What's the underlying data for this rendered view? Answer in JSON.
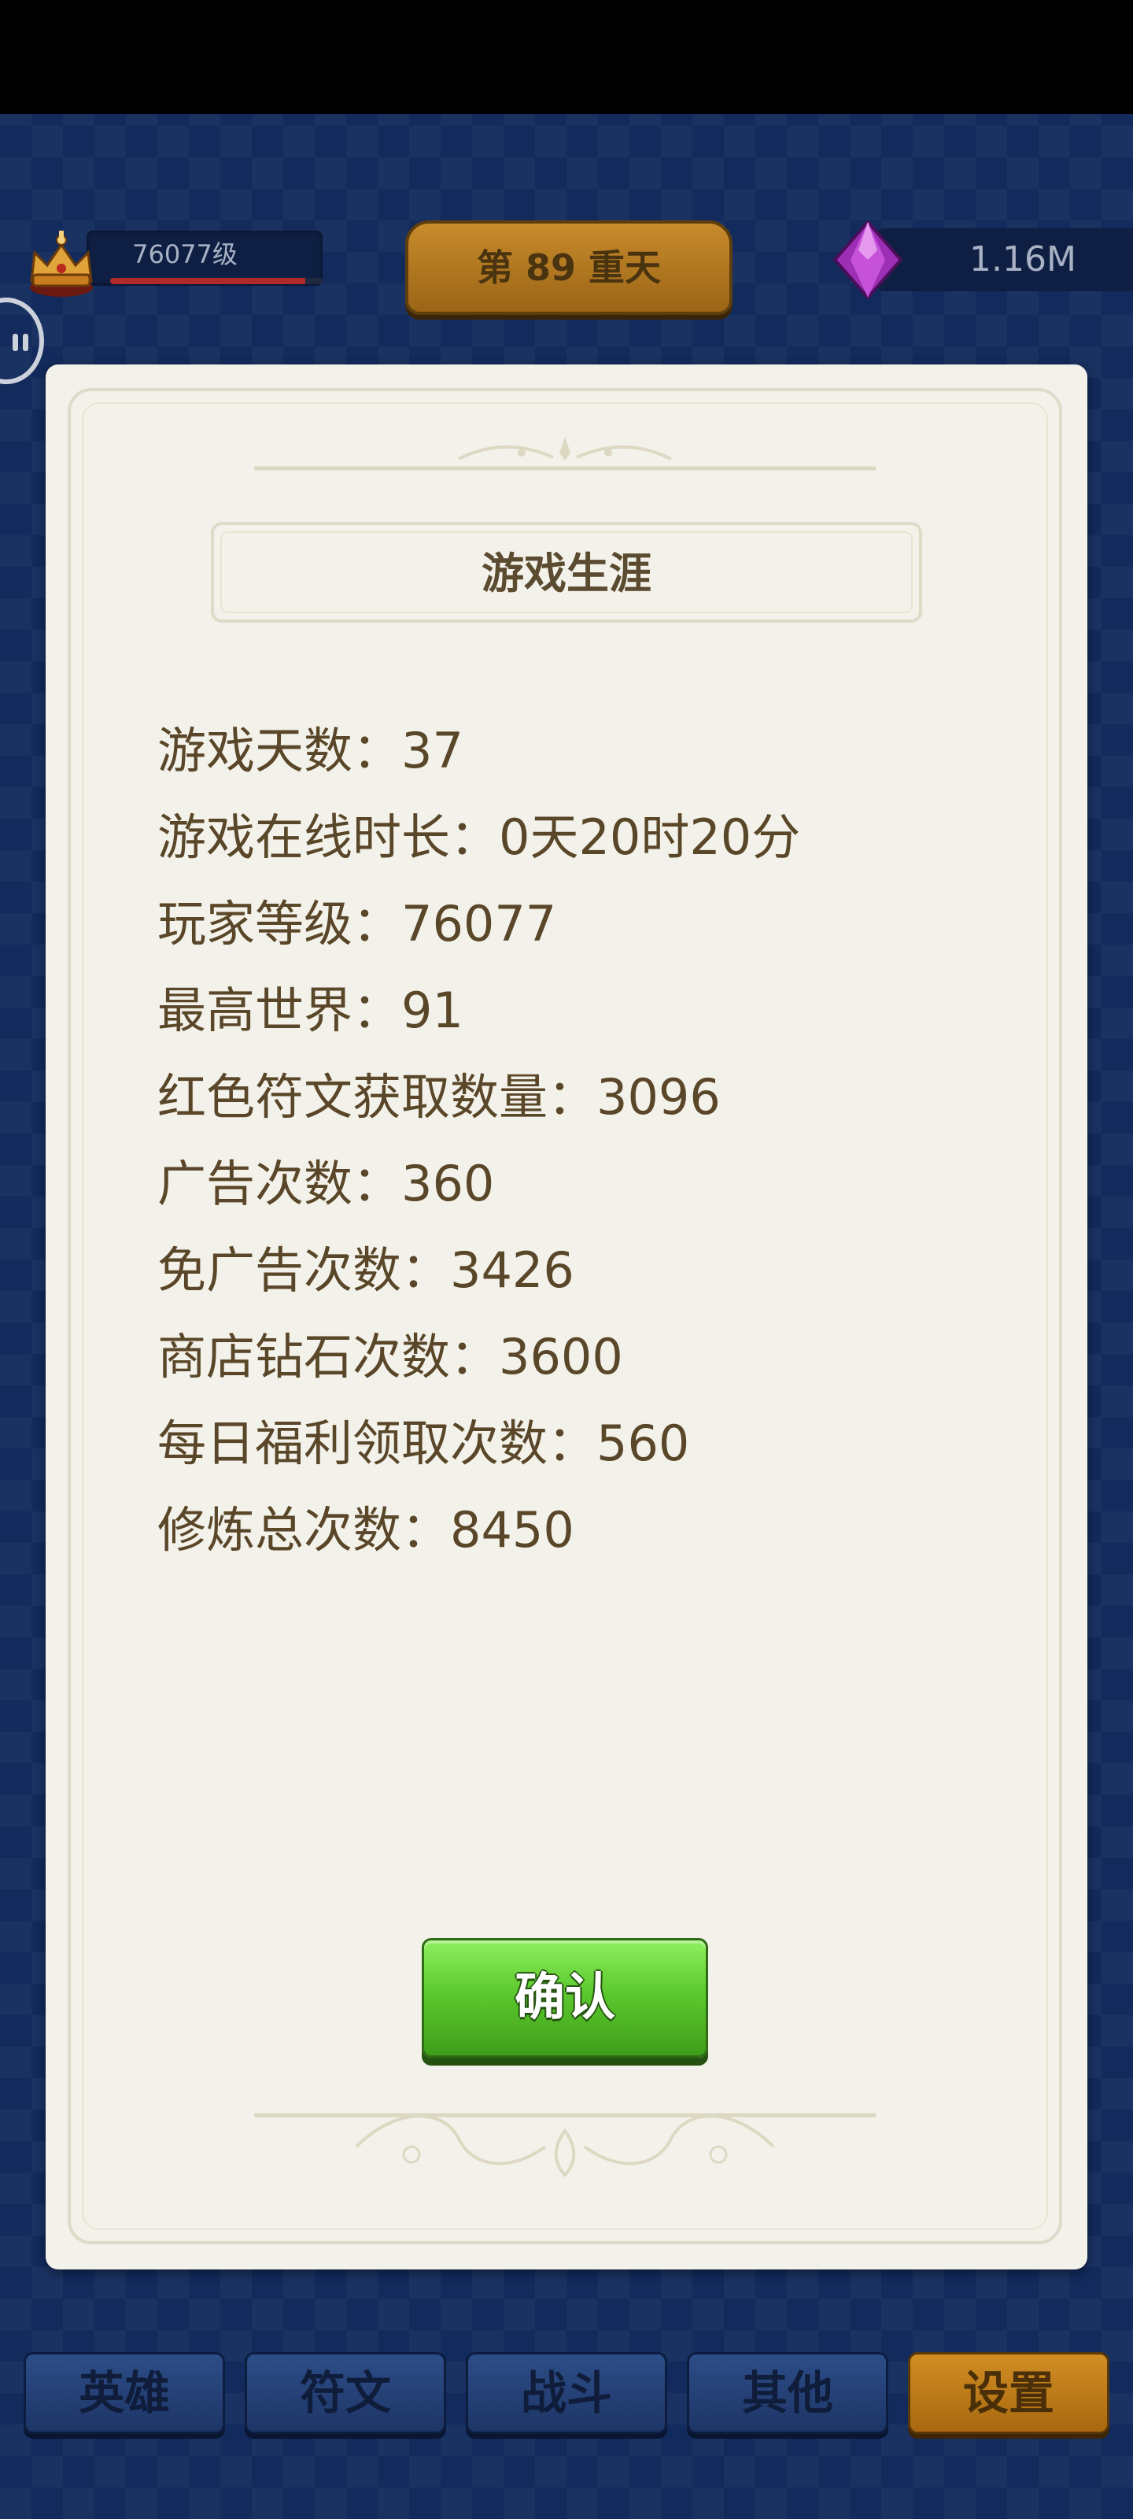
{
  "hud": {
    "level_text": "76077级",
    "level_progress": 0.92,
    "floor_text": "第 89 重天",
    "gems_text": "1.16M",
    "icons": {
      "crown": "crown-icon",
      "gem": "purple-gem-icon",
      "side_handle": "side-drawer-handle-icon"
    }
  },
  "dialog": {
    "title": "游戏生涯",
    "stats": [
      "游戏天数：37",
      "游戏在线时长：0天20时20分",
      "玩家等级：76077",
      "最高世界：91",
      "红色符文获取数量：3096",
      "广告次数：360",
      "免广告次数：3426",
      "商店钻石次数：3600",
      "每日福利领取次数：560",
      "修炼总次数：8450"
    ],
    "confirm_label": "确认"
  },
  "tabs": [
    {
      "label": "英雄",
      "active": false
    },
    {
      "label": "符文",
      "active": false
    },
    {
      "label": "战斗",
      "active": false
    },
    {
      "label": "其他",
      "active": false
    },
    {
      "label": "设置",
      "active": true
    }
  ],
  "colors": {
    "background": "#122a5c",
    "dialog_bg": "#f3f2ea",
    "text": "#5a4628",
    "confirm_green": "#5cc92e",
    "active_tab": "#d18e24",
    "inactive_tab": "#2d4d88"
  }
}
